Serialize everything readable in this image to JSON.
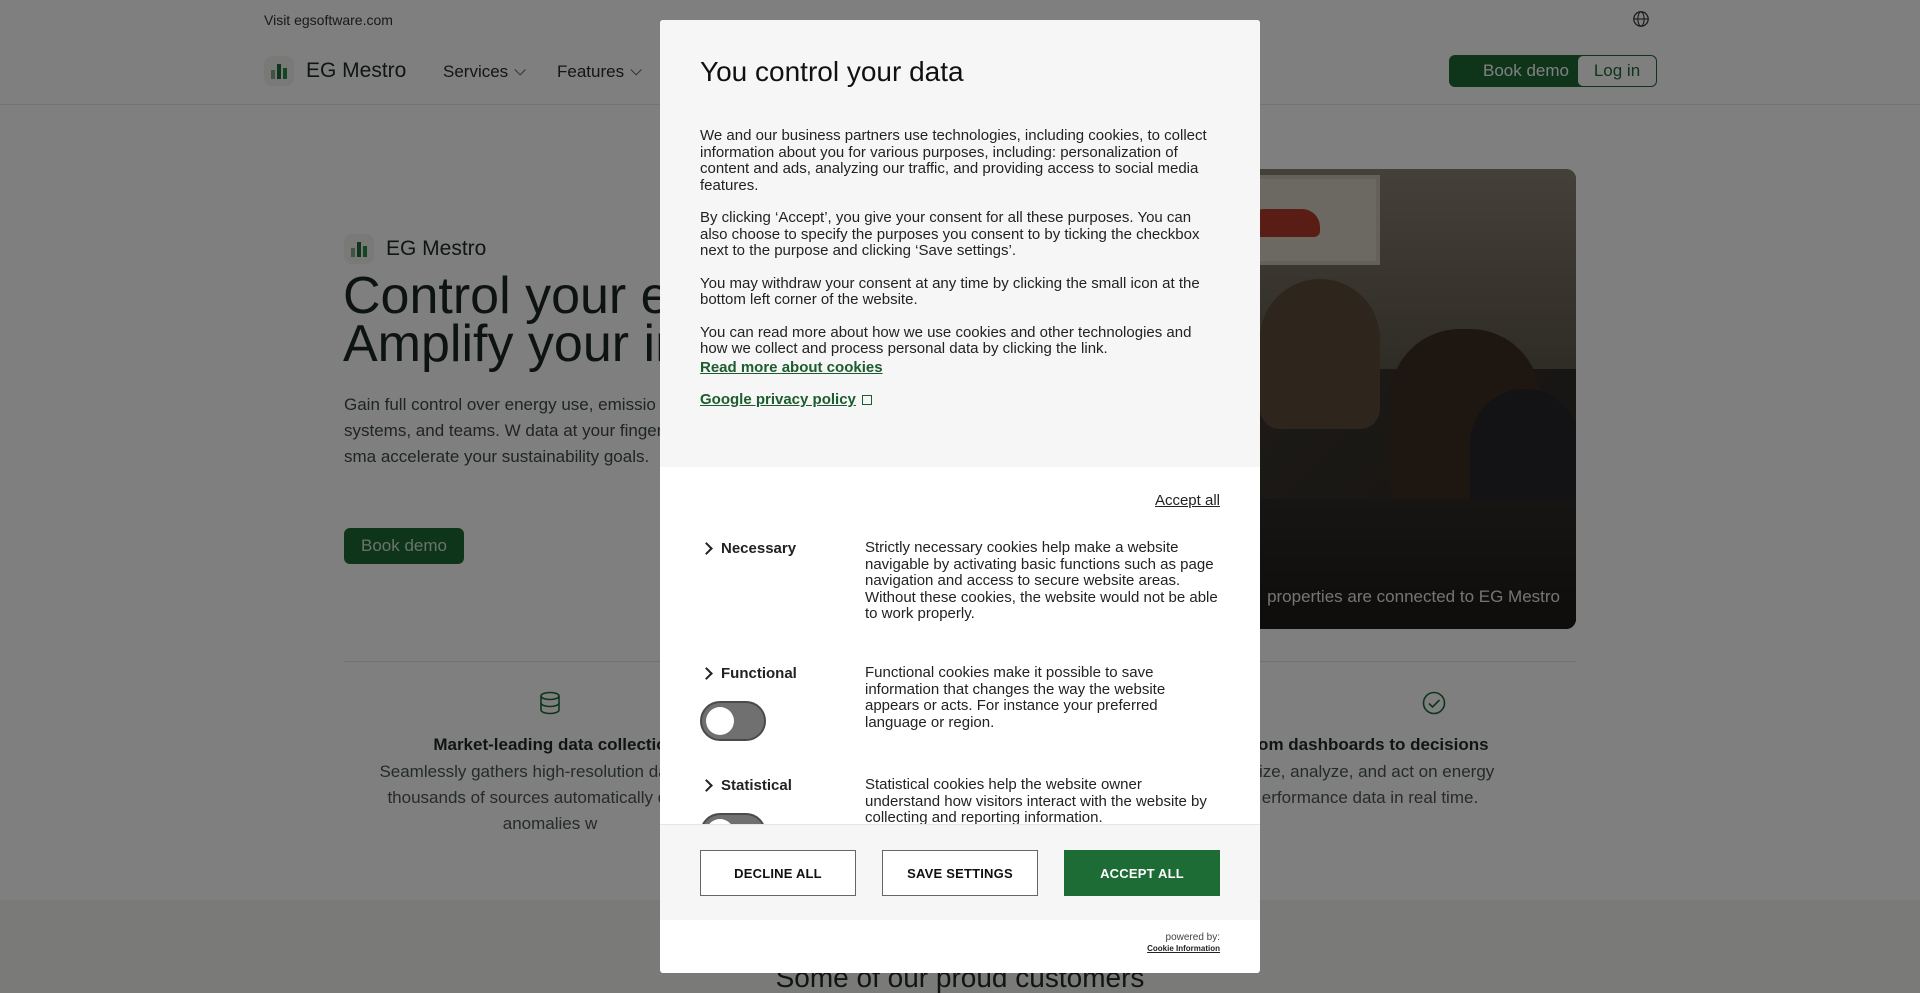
{
  "topbar": {
    "visit_text": "Visit egsoftware.com",
    "globe_icon": "globe-icon"
  },
  "nav": {
    "brand": "EG Mestro",
    "items": [
      {
        "label": "Services"
      },
      {
        "label": "Features"
      }
    ],
    "book_demo": "Book demo",
    "login": "Log in"
  },
  "hero": {
    "brand": "EG Mestro",
    "title_line1": "Control your en",
    "title_line2": "Amplify your in",
    "subtitle": "Gain full control over energy use, emissio across buildings, systems, and teams. W data at your fingertips, you can take sma accelerate your sustainability goals.",
    "cta": "Book demo",
    "photo_caption": "properties are connected to EG Mestro"
  },
  "features": [
    {
      "title": "Market-leading data collectio",
      "desc": "Seamlessly gathers high-resolution data from thousands of sources automatically detects anomalies w",
      "icon": "database-icon"
    },
    {
      "title": "rom dashboards to decisions",
      "desc": "alize, analyze, and act on energy erformance data in real time.",
      "icon": "check-circle-icon"
    }
  ],
  "customers": {
    "title": "Some of our proud customers"
  },
  "modal": {
    "title": "You control your data",
    "intro_p1": "We and our business partners use technologies, including cookies, to collect information about you for various purposes, including: personalization of content and ads, analyzing our traffic, and providing access to social media features.",
    "intro_p2": "By clicking ‘Accept’, you give your consent for all these purposes. You can also choose to specify the purposes you consent to by ticking the checkbox next to the purpose and clicking ‘Save settings’.",
    "intro_p3": "You may withdraw your consent at any time by clicking the small icon at the bottom left corner of the website.",
    "intro_p4": "You can read more about how we use cookies and other technologies and how we collect and process personal data by clicking the link.",
    "read_more_link": "Read more about cookies",
    "google_link": "Google privacy policy",
    "accept_all_link": "Accept all",
    "categories": [
      {
        "name": "Necessary",
        "desc": "Strictly necessary cookies help make a website navigable by activating basic functions such as page navigation and access to secure website areas. Without these cookies, the website would not be able to work properly.",
        "has_toggle": false
      },
      {
        "name": "Functional",
        "desc": "Functional cookies make it possible to save information that changes the way the website appears or acts. For instance your preferred language or region.",
        "has_toggle": true,
        "enabled": false
      },
      {
        "name": "Statistical",
        "desc": "Statistical cookies help the website owner understand how visitors interact with the website by collecting and reporting information.",
        "has_toggle": true,
        "enabled": false
      }
    ],
    "buttons": {
      "decline": "DECLINE ALL",
      "save": "SAVE SETTINGS",
      "accept": "ACCEPT ALL"
    },
    "powered_by": "powered by:",
    "powered_brand": "Cookie Information"
  },
  "colors": {
    "brand_green": "#1d6b35",
    "overlay": "rgba(0,0,0,0.5)"
  }
}
